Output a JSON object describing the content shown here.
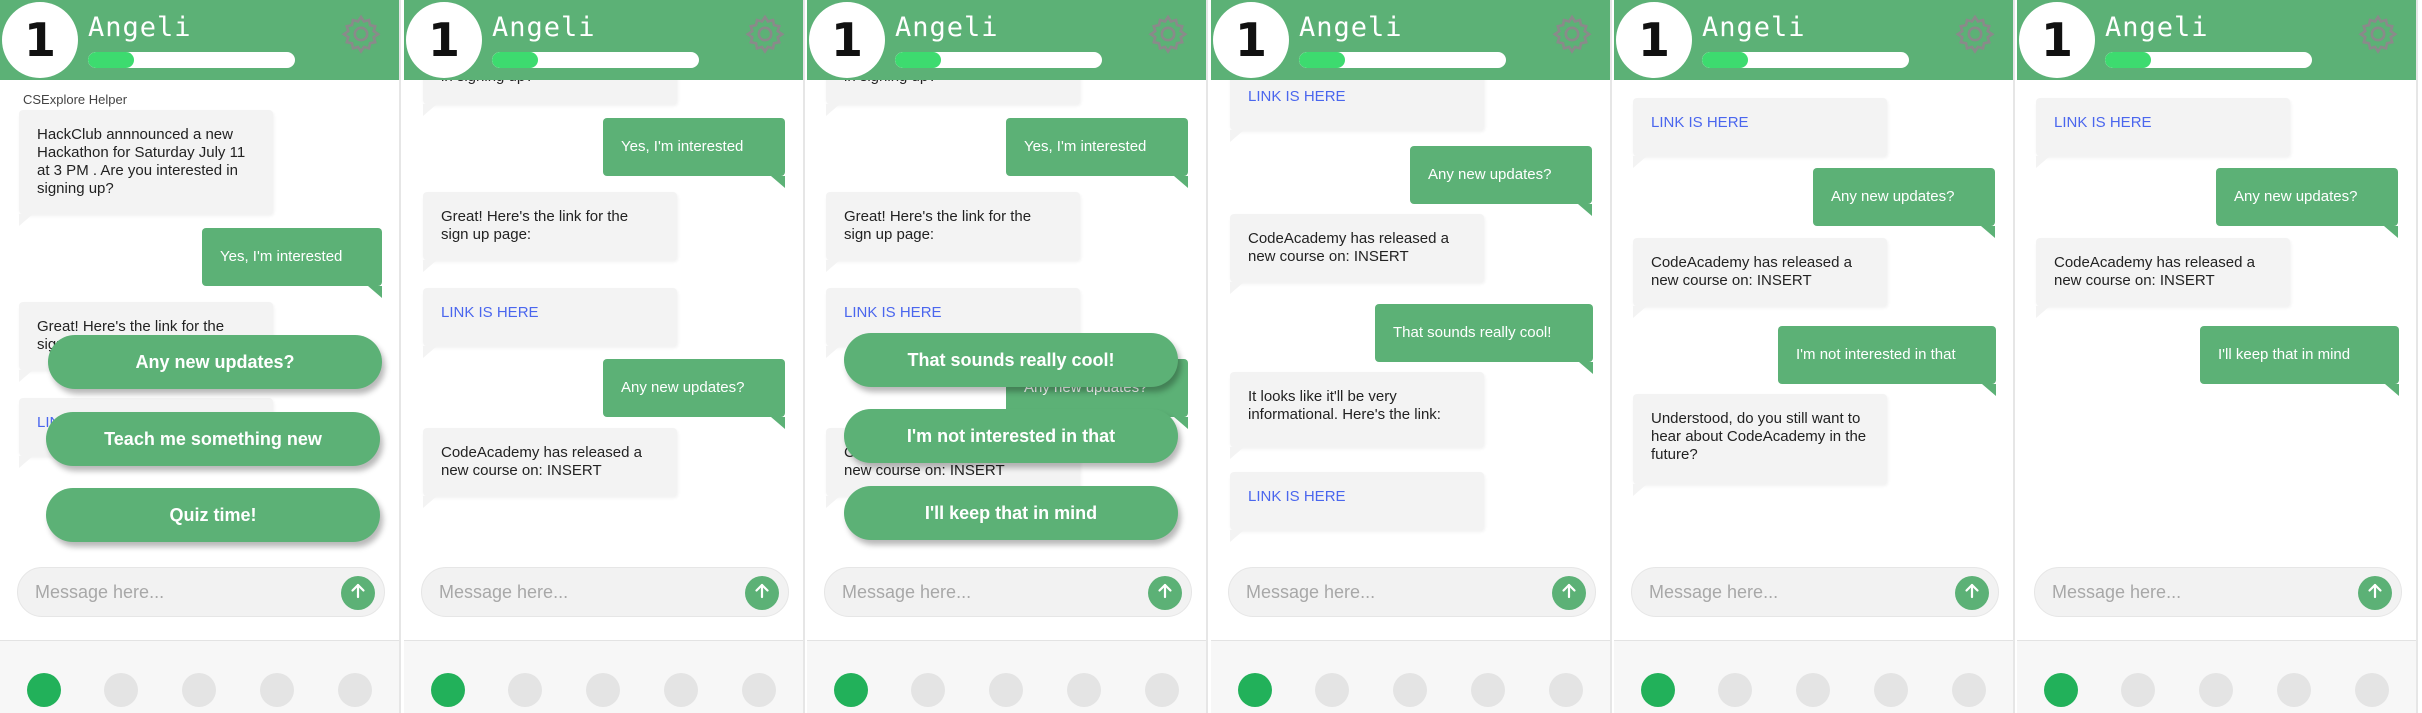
{
  "username": "Angeli",
  "level": "1",
  "progress": 0.22,
  "placeholder": "Message here...",
  "sender": "CSExplore Helper",
  "colors": {
    "accent": "#5cb176",
    "link": "#4a66ee",
    "dot_active": "#22b15a"
  },
  "icons": {
    "settings": "gear-icon",
    "send": "arrow-up-icon"
  },
  "texts": {
    "hackclub": "HackClub annnounced a new Hackathon for Saturday July 11 at 3 PM . Are you interested in signing up?",
    "hackclub_tail": "in signing up?",
    "yes": "Yes, I'm interested",
    "great": "Great! Here's the link for the sign up page:",
    "link": "LINK IS HERE",
    "updates": "Any new updates?",
    "codeacademy": "CodeAcademy has released a new course on: INSERT",
    "cool": "That sounds really cool!",
    "informational": "It looks like it'll be very informational. Here's the link:",
    "not_interested": "I'm not interested in that",
    "understood": "Understood, do you still want to hear about CodeAcademy in the future?",
    "keep": "I'll keep that in mind",
    "teach": "Teach me something new",
    "quiz": "Quiz time!"
  }
}
